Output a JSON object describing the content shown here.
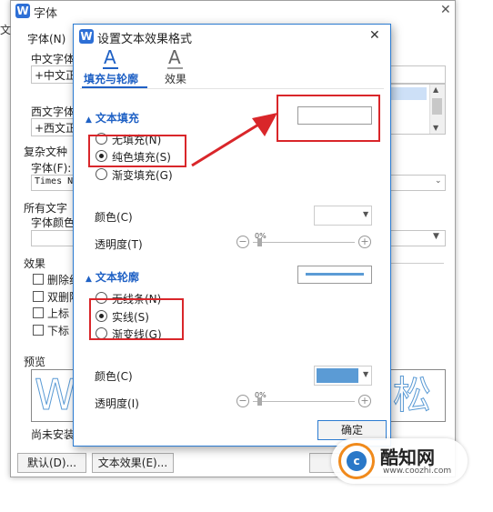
{
  "bg_dialog": {
    "title": "字体",
    "left_edge_label": "文",
    "font_label": "字体(N)",
    "chinese_font_label": "中文字体",
    "chinese_font_value": "+中文正",
    "western_font_label": "西文字体",
    "western_font_value": "+西文正",
    "complex_label": "复杂文种",
    "complex_font_label": "字体(F):",
    "complex_font_value": "Times N",
    "all_text_label": "所有文字",
    "font_color_label": "字体颜色",
    "effects_label": "效果",
    "effects": [
      "删除线",
      "双删除",
      "上标",
      "下标"
    ],
    "preview_label": "预览",
    "preview_left_glyph": "W",
    "preview_right_glyph": "松",
    "note": "尚未安装",
    "default_button": "默认(D)...",
    "text_effect_button": "文本效果(E)...",
    "close_glyph": "✕"
  },
  "dialog": {
    "title": "设置文本效果格式",
    "close_glyph": "✕",
    "tabs": [
      {
        "label": "填充与轮廓",
        "glyph": "A",
        "active": true
      },
      {
        "label": "效果",
        "glyph": "A",
        "active": false
      }
    ],
    "fill": {
      "section_title": "文本填充",
      "options": [
        "无填充(N)",
        "纯色填充(S)",
        "渐变填充(G)"
      ],
      "selected": 1,
      "color_label": "颜色(C)",
      "transparency_label": "透明度(T)",
      "transparency_value": "0%"
    },
    "outline": {
      "section_title": "文本轮廓",
      "options": [
        "无线条(N)",
        "实线(S)",
        "渐变线(G)"
      ],
      "selected": 1,
      "color_label": "颜色(C)",
      "transparency_label": "透明度(I)",
      "transparency_value": "0%"
    },
    "ok_button": "确定"
  },
  "watermark": {
    "brand": "酷知网",
    "url": "www.coozhi.com"
  },
  "colors": {
    "accent": "#1f61c5",
    "annotation_red": "#d9262a",
    "outline_color": "#5b9bd5",
    "dialog_border": "#2b7bd1"
  }
}
